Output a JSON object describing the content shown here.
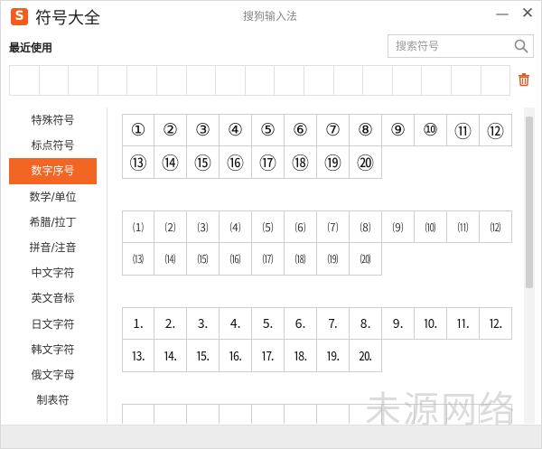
{
  "window": {
    "title": "符号大全",
    "logo_text": "S",
    "ime_name": "搜狗输入法",
    "minimize_glyph": "—",
    "close_glyph": "✕"
  },
  "recent": {
    "label": "最近使用",
    "slot_count": 17
  },
  "search": {
    "placeholder": "搜索符号",
    "value": ""
  },
  "sidebar": {
    "items": [
      {
        "label": "特殊符号",
        "active": false
      },
      {
        "label": "标点符号",
        "active": false
      },
      {
        "label": "数字序号",
        "active": true
      },
      {
        "label": "数学/单位",
        "active": false
      },
      {
        "label": "希腊/拉丁",
        "active": false
      },
      {
        "label": "拼音/注音",
        "active": false
      },
      {
        "label": "中文字符",
        "active": false
      },
      {
        "label": "英文音标",
        "active": false
      },
      {
        "label": "日文字符",
        "active": false
      },
      {
        "label": "韩文字符",
        "active": false
      },
      {
        "label": "俄文字母",
        "active": false
      },
      {
        "label": "制表符",
        "active": false
      }
    ]
  },
  "symbol_groups": [
    {
      "name": "circled-numbers",
      "symbols": [
        "①",
        "②",
        "③",
        "④",
        "⑤",
        "⑥",
        "⑦",
        "⑧",
        "⑨",
        "⑩",
        "⑪",
        "⑫",
        "⑬",
        "⑭",
        "⑮",
        "⑯",
        "⑰",
        "⑱",
        "⑲",
        "⑳"
      ]
    },
    {
      "name": "parenthesized-numbers",
      "symbols": [
        "⑴",
        "⑵",
        "⑶",
        "⑷",
        "⑸",
        "⑹",
        "⑺",
        "⑻",
        "⑼",
        "⑽",
        "⑾",
        "⑿",
        "⒀",
        "⒁",
        "⒂",
        "⒃",
        "⒄",
        "⒅",
        "⒆",
        "⒇"
      ]
    },
    {
      "name": "period-numbers",
      "symbols": [
        "⒈",
        "⒉",
        "⒊",
        "⒋",
        "⒌",
        "⒍",
        "⒎",
        "⒏",
        "⒐",
        "⒑",
        "⒒",
        "⒓",
        "⒔",
        "⒕",
        "⒖",
        "⒗",
        "⒘",
        "⒙",
        "⒚",
        "⒛"
      ]
    }
  ],
  "watermark": "未源网络",
  "colors": {
    "accent": "#f26523",
    "logo": "#f25b1b",
    "trash": "#e8591f"
  }
}
